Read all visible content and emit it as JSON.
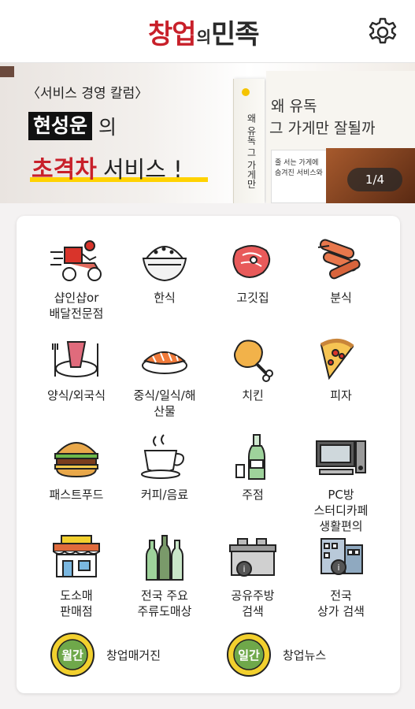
{
  "header": {
    "logo": {
      "part1": "창업",
      "part2": "의",
      "part3": "민족"
    },
    "settings_icon": "gear-icon"
  },
  "banner": {
    "subtitle": "〈서비스 경영 칼럼〉",
    "name": "현성운",
    "particle": "의",
    "highlight": "초격차",
    "rest": "서비스 !",
    "book_spine": "왜 유독 그 가게만",
    "book_title_1": "왜 유독",
    "book_title_2": "그 가게만 잘될까",
    "book_card": "줄 서는 가게에 숨겨진 서비스와",
    "counter": "1/4"
  },
  "categories": [
    {
      "label": "샵인샵or\n배달전문점",
      "icon": "delivery-scooter-icon"
    },
    {
      "label": "한식",
      "icon": "rice-bowl-icon"
    },
    {
      "label": "고깃집",
      "icon": "meat-icon"
    },
    {
      "label": "분식",
      "icon": "sausage-icon"
    },
    {
      "label": "양식/외국식",
      "icon": "western-dish-icon"
    },
    {
      "label": "중식/일식/해\n산물",
      "icon": "sushi-icon"
    },
    {
      "label": "치킨",
      "icon": "chicken-leg-icon"
    },
    {
      "label": "피자",
      "icon": "pizza-slice-icon"
    },
    {
      "label": "패스트푸드",
      "icon": "burger-icon"
    },
    {
      "label": "커피/음료",
      "icon": "coffee-cup-icon"
    },
    {
      "label": "주점",
      "icon": "soju-bottle-icon"
    },
    {
      "label": "PC방\n스터디카페\n생활편의",
      "icon": "pc-icon"
    },
    {
      "label": "도소매\n판매점",
      "icon": "store-icon"
    },
    {
      "label": "전국 주요\n주류도매상",
      "icon": "liquor-bottles-icon"
    },
    {
      "label": "공유주방\n검색",
      "icon": "shared-kitchen-icon"
    },
    {
      "label": "전국\n상가 검색",
      "icon": "building-search-icon"
    }
  ],
  "extras": [
    {
      "label": "창업매거진",
      "badge": "월간",
      "icon": "monthly-badge-icon"
    },
    {
      "label": "창업뉴스",
      "badge": "일간",
      "icon": "daily-badge-icon"
    }
  ],
  "colors": {
    "brand_red": "#c8202a",
    "highlight_yellow": "#ffd200",
    "badge_green": "#6fa84a",
    "badge_yellow": "#f2d02e"
  }
}
